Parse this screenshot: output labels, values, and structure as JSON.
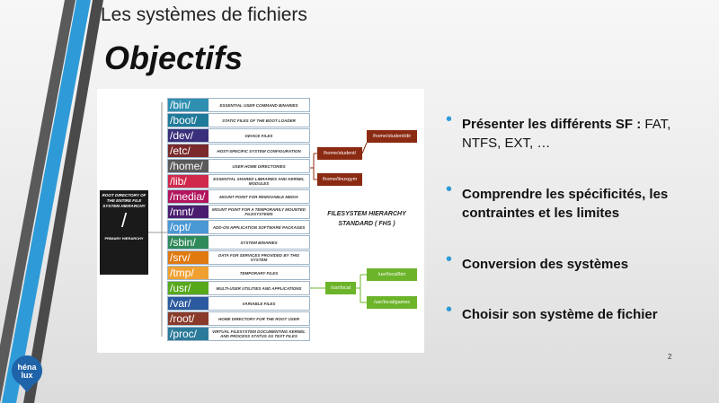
{
  "header": {
    "subtitle": "Les systèmes de fichiers",
    "title": "Objectifs"
  },
  "figure": {
    "root": {
      "label": "ROOT DIRECTORY OF THE ENTIRE FILE SYSTEM HIERARCHY",
      "slash": "/",
      "primary": "PRIMARY HIERARCHY"
    },
    "dirs": [
      {
        "name": "/bin/",
        "desc": "ESSENTIAL USER COMMAND BINARIES",
        "color": "#2f8fb0"
      },
      {
        "name": "/boot/",
        "desc": "STATIC FILES OF THE BOOT LOADER",
        "color": "#1f7a9a"
      },
      {
        "name": "/dev/",
        "desc": "DEVICE FILES",
        "color": "#3a2f7a"
      },
      {
        "name": "/etc/",
        "desc": "HOST-SPECIFIC SYSTEM CONFIGURATION",
        "color": "#7a2a2a"
      },
      {
        "name": "/home/",
        "desc": "USER HOME DIRECTORIES",
        "color": "#5a5a5a"
      },
      {
        "name": "/lib/",
        "desc": "ESSENTIAL SHARED LIBRARIES AND KERNEL MODULES",
        "color": "#d0284a"
      },
      {
        "name": "/media/",
        "desc": "MOUNT POINT FOR REMOVABLE MEDIA",
        "color": "#b2155e"
      },
      {
        "name": "/mnt/",
        "desc": "MOUNT POINT FOR A TEMPORARILY MOUNTED FILESYSTEMS",
        "color": "#4b1d6e"
      },
      {
        "name": "/opt/",
        "desc": "ADD-ON APPLICATION SOFTWARE PACKAGES",
        "color": "#4a98d4"
      },
      {
        "name": "/sbin/",
        "desc": "SYSTEM BINARIES",
        "color": "#2f8a5a"
      },
      {
        "name": "/srv/",
        "desc": "DATA FOR SERVICES PROVIDED BY THIS SYSTEM",
        "color": "#e07a10"
      },
      {
        "name": "/tmp/",
        "desc": "TEMPORARY FILES",
        "color": "#f0a030"
      },
      {
        "name": "/usr/",
        "desc": "MULTI-USER UTILITIES AND APPLICATIONS",
        "color": "#58a81c"
      },
      {
        "name": "/var/",
        "desc": "VARIABLE FILES",
        "color": "#2c5aa0"
      },
      {
        "name": "/root/",
        "desc": "HOME DIRECTORY FOR THE ROOT USER",
        "color": "#8a3a2a"
      },
      {
        "name": "/proc/",
        "desc": "VIRTUAL FILESYSTEM DOCUMENTING KERNEL AND PROCESS STATUS AS TEXT FILES",
        "color": "#2c7a9a"
      }
    ],
    "side": {
      "home_student": "/home/student/",
      "home_student_dir": "/home/student/dir",
      "home_linuxgym": "/home/linuxgym",
      "usr_local": "/usr/local",
      "usr_local_bin": "/usr/local/bin",
      "usr_local_games": "/usr/local/games"
    },
    "fhs_title": "FILESYSTEM HIERARCHY STANDARD ( FHS )",
    "colors": {
      "home": "#8b2a12",
      "usr": "#6cb42a"
    }
  },
  "bullets": [
    {
      "bold": "Présenter les différents SF :",
      "text": " FAT, NTFS, EXT, …"
    },
    {
      "bold": "Comprendre les spécificités, les contraintes et les limites",
      "text": ""
    },
    {
      "bold": "Conversion des systèmes",
      "text": ""
    },
    {
      "bold": "Choisir son système de fichier",
      "text": ""
    }
  ],
  "page_number": "2",
  "logo": {
    "line1": "héna",
    "line2": "lux"
  },
  "accent": "#2e9bd8"
}
